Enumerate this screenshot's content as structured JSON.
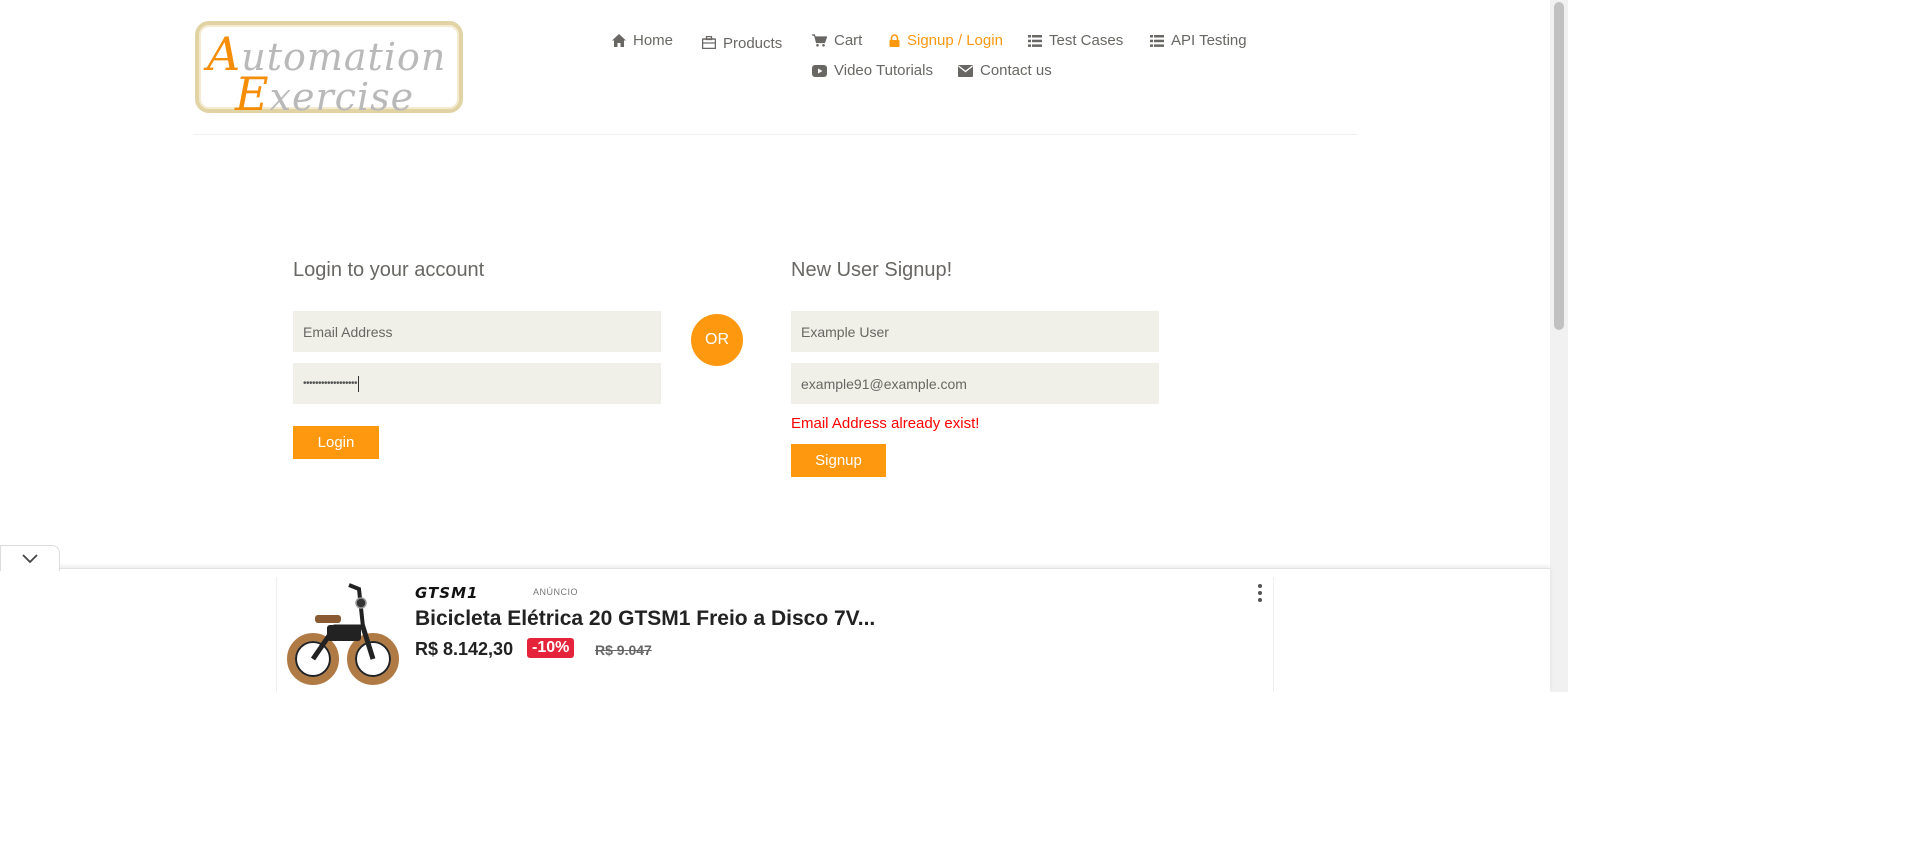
{
  "colors": {
    "accent": "#fe980f",
    "text": "#696763",
    "error": "#ff0000",
    "input_bg": "#f0f0e9",
    "discount": "#e5243b"
  },
  "logo": {
    "line1_cap": "A",
    "line1_rest": "utomation",
    "line2_cap": "E",
    "line2_rest": "xercise"
  },
  "nav": {
    "home": {
      "label": "Home",
      "icon": "home-icon"
    },
    "products": {
      "label": "Products",
      "icon": "briefcase-icon"
    },
    "cart": {
      "label": "Cart",
      "icon": "cart-icon"
    },
    "signup_login": {
      "label": "Signup / Login",
      "icon": "lock-icon"
    },
    "test_cases": {
      "label": "Test Cases",
      "icon": "list-icon"
    },
    "api_testing": {
      "label": "API Testing",
      "icon": "list-icon"
    },
    "video_tutorials": {
      "label": "Video Tutorials",
      "icon": "youtube-play-icon"
    },
    "contact_us": {
      "label": "Contact us",
      "icon": "envelope-icon"
    }
  },
  "login": {
    "title": "Login to your account",
    "email_placeholder": "Email Address",
    "email_value": "",
    "password_value": "••••••••••••••••••",
    "button": "Login"
  },
  "or_label": "OR",
  "signup": {
    "title": "New User Signup!",
    "name_value": "Example User",
    "email_value": "example91@example.com",
    "error": "Email Address already exist!",
    "button": "Signup"
  },
  "ad": {
    "brand": "GTSM1",
    "tag": "ANÚNCIO",
    "title": "Bicicleta Elétrica 20 GTSM1 Freio a Disco 7V...",
    "price": "R$ 8.142,30",
    "discount": "-10%",
    "old_price": "R$ 9.047",
    "collapse_icon": "chevron-down-icon",
    "menu_icon": "more-vertical-icon"
  }
}
